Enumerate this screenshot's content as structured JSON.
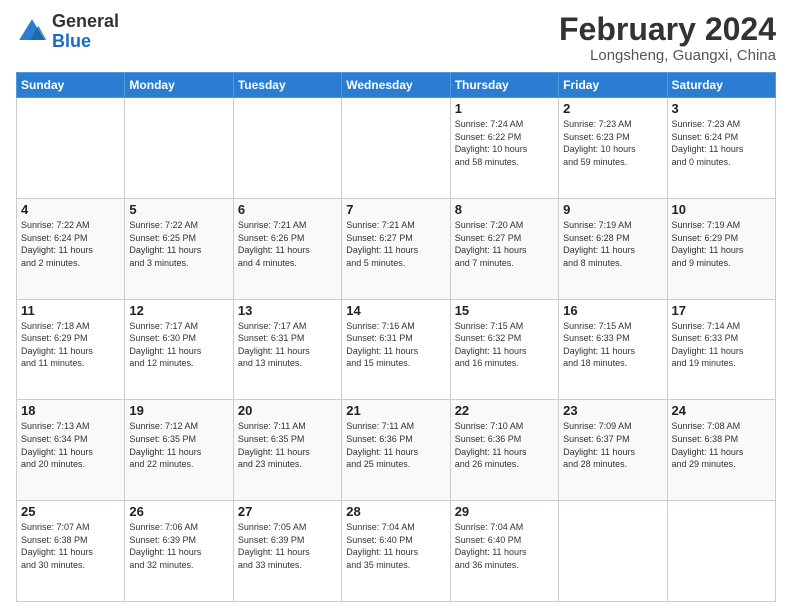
{
  "header": {
    "logo_line1": "General",
    "logo_line2": "Blue",
    "month_year": "February 2024",
    "location": "Longsheng, Guangxi, China"
  },
  "weekdays": [
    "Sunday",
    "Monday",
    "Tuesday",
    "Wednesday",
    "Thursday",
    "Friday",
    "Saturday"
  ],
  "weeks": [
    [
      {
        "day": "",
        "info": ""
      },
      {
        "day": "",
        "info": ""
      },
      {
        "day": "",
        "info": ""
      },
      {
        "day": "",
        "info": ""
      },
      {
        "day": "1",
        "info": "Sunrise: 7:24 AM\nSunset: 6:22 PM\nDaylight: 10 hours\nand 58 minutes."
      },
      {
        "day": "2",
        "info": "Sunrise: 7:23 AM\nSunset: 6:23 PM\nDaylight: 10 hours\nand 59 minutes."
      },
      {
        "day": "3",
        "info": "Sunrise: 7:23 AM\nSunset: 6:24 PM\nDaylight: 11 hours\nand 0 minutes."
      }
    ],
    [
      {
        "day": "4",
        "info": "Sunrise: 7:22 AM\nSunset: 6:24 PM\nDaylight: 11 hours\nand 2 minutes."
      },
      {
        "day": "5",
        "info": "Sunrise: 7:22 AM\nSunset: 6:25 PM\nDaylight: 11 hours\nand 3 minutes."
      },
      {
        "day": "6",
        "info": "Sunrise: 7:21 AM\nSunset: 6:26 PM\nDaylight: 11 hours\nand 4 minutes."
      },
      {
        "day": "7",
        "info": "Sunrise: 7:21 AM\nSunset: 6:27 PM\nDaylight: 11 hours\nand 5 minutes."
      },
      {
        "day": "8",
        "info": "Sunrise: 7:20 AM\nSunset: 6:27 PM\nDaylight: 11 hours\nand 7 minutes."
      },
      {
        "day": "9",
        "info": "Sunrise: 7:19 AM\nSunset: 6:28 PM\nDaylight: 11 hours\nand 8 minutes."
      },
      {
        "day": "10",
        "info": "Sunrise: 7:19 AM\nSunset: 6:29 PM\nDaylight: 11 hours\nand 9 minutes."
      }
    ],
    [
      {
        "day": "11",
        "info": "Sunrise: 7:18 AM\nSunset: 6:29 PM\nDaylight: 11 hours\nand 11 minutes."
      },
      {
        "day": "12",
        "info": "Sunrise: 7:17 AM\nSunset: 6:30 PM\nDaylight: 11 hours\nand 12 minutes."
      },
      {
        "day": "13",
        "info": "Sunrise: 7:17 AM\nSunset: 6:31 PM\nDaylight: 11 hours\nand 13 minutes."
      },
      {
        "day": "14",
        "info": "Sunrise: 7:16 AM\nSunset: 6:31 PM\nDaylight: 11 hours\nand 15 minutes."
      },
      {
        "day": "15",
        "info": "Sunrise: 7:15 AM\nSunset: 6:32 PM\nDaylight: 11 hours\nand 16 minutes."
      },
      {
        "day": "16",
        "info": "Sunrise: 7:15 AM\nSunset: 6:33 PM\nDaylight: 11 hours\nand 18 minutes."
      },
      {
        "day": "17",
        "info": "Sunrise: 7:14 AM\nSunset: 6:33 PM\nDaylight: 11 hours\nand 19 minutes."
      }
    ],
    [
      {
        "day": "18",
        "info": "Sunrise: 7:13 AM\nSunset: 6:34 PM\nDaylight: 11 hours\nand 20 minutes."
      },
      {
        "day": "19",
        "info": "Sunrise: 7:12 AM\nSunset: 6:35 PM\nDaylight: 11 hours\nand 22 minutes."
      },
      {
        "day": "20",
        "info": "Sunrise: 7:11 AM\nSunset: 6:35 PM\nDaylight: 11 hours\nand 23 minutes."
      },
      {
        "day": "21",
        "info": "Sunrise: 7:11 AM\nSunset: 6:36 PM\nDaylight: 11 hours\nand 25 minutes."
      },
      {
        "day": "22",
        "info": "Sunrise: 7:10 AM\nSunset: 6:36 PM\nDaylight: 11 hours\nand 26 minutes."
      },
      {
        "day": "23",
        "info": "Sunrise: 7:09 AM\nSunset: 6:37 PM\nDaylight: 11 hours\nand 28 minutes."
      },
      {
        "day": "24",
        "info": "Sunrise: 7:08 AM\nSunset: 6:38 PM\nDaylight: 11 hours\nand 29 minutes."
      }
    ],
    [
      {
        "day": "25",
        "info": "Sunrise: 7:07 AM\nSunset: 6:38 PM\nDaylight: 11 hours\nand 30 minutes."
      },
      {
        "day": "26",
        "info": "Sunrise: 7:06 AM\nSunset: 6:39 PM\nDaylight: 11 hours\nand 32 minutes."
      },
      {
        "day": "27",
        "info": "Sunrise: 7:05 AM\nSunset: 6:39 PM\nDaylight: 11 hours\nand 33 minutes."
      },
      {
        "day": "28",
        "info": "Sunrise: 7:04 AM\nSunset: 6:40 PM\nDaylight: 11 hours\nand 35 minutes."
      },
      {
        "day": "29",
        "info": "Sunrise: 7:04 AM\nSunset: 6:40 PM\nDaylight: 11 hours\nand 36 minutes."
      },
      {
        "day": "",
        "info": ""
      },
      {
        "day": "",
        "info": ""
      }
    ]
  ]
}
